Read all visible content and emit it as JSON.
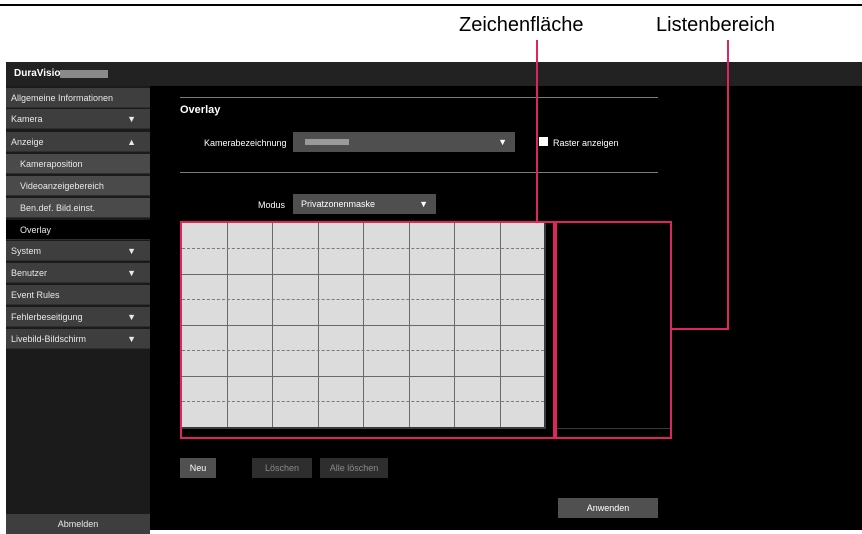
{
  "annotations": {
    "zeichenflaeche": "Zeichenfläche",
    "listenbereich": "Listenbereich"
  },
  "app": {
    "brand": "DuraVision"
  },
  "sidebar": {
    "items": [
      {
        "label": "Allgemeine Informationen",
        "arrow": ""
      },
      {
        "label": "Kamera",
        "arrow": "▼"
      },
      {
        "label": "Anzeige",
        "arrow": "▲"
      },
      {
        "label": "Kameraposition",
        "arrow": ""
      },
      {
        "label": "Videoanzeigebereich",
        "arrow": ""
      },
      {
        "label": "Ben.def. Bild.einst.",
        "arrow": ""
      },
      {
        "label": "Overlay",
        "arrow": ""
      },
      {
        "label": "System",
        "arrow": "▼"
      },
      {
        "label": "Benutzer",
        "arrow": "▼"
      },
      {
        "label": "Event Rules",
        "arrow": ""
      },
      {
        "label": "Fehlerbeseitigung",
        "arrow": "▼"
      },
      {
        "label": "Livebild-Bildschirm",
        "arrow": "▼"
      }
    ],
    "active_item": "Overlay",
    "logout_label": "Abmelden"
  },
  "main": {
    "title": "Overlay",
    "camera_label": "Kamerabezeichnung",
    "camera_select_caret": "▼",
    "grid_checkbox_label": "Raster anzeigen",
    "grid_checkbox_checked": false,
    "mode_label": "Modus",
    "mode_value": "Privatzonenmaske",
    "mode_caret": "▼",
    "canvas_color": "#dcdcdc",
    "accent_color": "#e0245e",
    "buttons": {
      "new": "Neu",
      "delete": "Löschen",
      "delete_all": "Alle löschen",
      "apply": "Anwenden"
    }
  }
}
